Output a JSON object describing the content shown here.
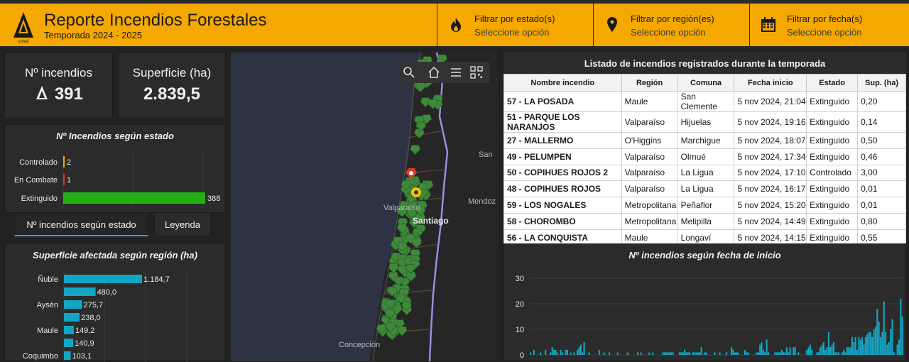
{
  "header": {
    "title": "Reporte Incendios Forestales",
    "subtitle": "Temporada 2024 - 2025",
    "logo_text": "conaf",
    "filters": [
      {
        "label": "Filtrar por estado(s)",
        "value": "Seleccione opción",
        "icon": "fire-icon"
      },
      {
        "label": "Filtrar por región(es)",
        "value": "Seleccione opción",
        "icon": "map-pin-icon"
      },
      {
        "label": "Filtrar por fecha(s)",
        "value": "Seleccione opción",
        "icon": "calendar-icon"
      }
    ]
  },
  "kpis": {
    "incendios_label": "Nº incendios",
    "incendios_value": "391",
    "superficie_label": "Superficie (ha)",
    "superficie_value": "2.839,5"
  },
  "tabs": {
    "estado": "Nº incendios según estado",
    "leyenda": "Leyenda"
  },
  "map": {
    "labels": [
      "Valparaíso",
      "Santiago",
      "Mendoz",
      "San",
      "Concepción"
    ]
  },
  "table": {
    "title": "Listado de incendios registrados durante la temporada",
    "columns": [
      "Nombre incendio",
      "Región",
      "Comuna",
      "Fecha inicio",
      "Estado",
      "Sup. (ha)"
    ],
    "rows": [
      [
        "57 - LA POSADA",
        "Maule",
        "San Clemente",
        "5 nov 2024, 21:04",
        "Extinguido",
        "0,20"
      ],
      [
        "51 - PARQUE LOS NARANJOS",
        "Valparaíso",
        "Hijuelas",
        "5 nov 2024, 19:16",
        "Extinguido",
        "0,14"
      ],
      [
        "27 - MALLERMO",
        "O'Higgins",
        "Marchigue",
        "5 nov 2024, 18:07",
        "Extinguido",
        "0,50"
      ],
      [
        "49 - PELUMPEN",
        "Valparaíso",
        "Olmué",
        "5 nov 2024, 17:34",
        "Extinguido",
        "0,46"
      ],
      [
        "50 - COPIHUES ROJOS 2",
        "Valparaíso",
        "La Ligua",
        "5 nov 2024, 17:10",
        "Controlado",
        "3,00"
      ],
      [
        "48 - COPIHUES ROJOS",
        "Valparaíso",
        "La Ligua",
        "5 nov 2024, 16:17",
        "Extinguido",
        "0,01"
      ],
      [
        "59 - LOS NOGALES",
        "Metropolitana",
        "Peñaflor",
        "5 nov 2024, 15:20",
        "Extinguido",
        "0,01"
      ],
      [
        "58 - CHOROMBO",
        "Metropolitana",
        "Melipilla",
        "5 nov 2024, 14:49",
        "Extinguido",
        "0,80"
      ],
      [
        "56 - LA CONQUISTA",
        "Maule",
        "Longaví",
        "5 nov 2024, 14:15",
        "Extinguido",
        "0,55"
      ]
    ]
  },
  "colors": {
    "header_bg": "#f5a800",
    "extinguido": "#22b014",
    "controlado": "#f5a800",
    "en_combate": "#d93a2b",
    "bar_region": "#13a6c4",
    "bar_fecha": "#13a6c4"
  },
  "chart_data": [
    {
      "type": "bar",
      "title": "Nº Incendios según estado",
      "categories": [
        "Controlado",
        "En Combate",
        "Extinguido"
      ],
      "values": [
        2,
        1,
        388
      ],
      "labels": [
        "2",
        "1",
        "388"
      ],
      "orientation": "horizontal"
    },
    {
      "type": "bar",
      "title": "Superficie afectada según región (ha)",
      "categories": [
        "Ñuble",
        "",
        "Aysén",
        "",
        "Maule",
        "",
        "Coquimbo"
      ],
      "values": [
        1184.7,
        480.0,
        275.7,
        238.0,
        149.2,
        140.9,
        103.1
      ],
      "labels": [
        "1.184,7",
        "480,0",
        "275,7",
        "238,0",
        "149,2",
        "140,9",
        "103,1"
      ],
      "orientation": "horizontal"
    },
    {
      "type": "bar",
      "title": "Nº incendios según fecha de inicio",
      "ylim": [
        0,
        30
      ],
      "yticks": [
        0,
        10,
        20,
        30
      ],
      "values": [
        1,
        0,
        2,
        0,
        0,
        0,
        1,
        0,
        0,
        2,
        0,
        0,
        1,
        3,
        2,
        2,
        1,
        0,
        2,
        1,
        0,
        2,
        2,
        0,
        1,
        0,
        1,
        0,
        2,
        3,
        4,
        1,
        5,
        0,
        0,
        1,
        0,
        0,
        0,
        0,
        0,
        2,
        0,
        0,
        1,
        0,
        0,
        1,
        0,
        0,
        0,
        0,
        1,
        0,
        0,
        0,
        0,
        0,
        1,
        0,
        0,
        0,
        0,
        0,
        1,
        0,
        1,
        0,
        0,
        0,
        0,
        1,
        0,
        1,
        0,
        0,
        0,
        0,
        0,
        1,
        1,
        1,
        1,
        1,
        1,
        1,
        0,
        0,
        0,
        1,
        1,
        1,
        2,
        1,
        1,
        1,
        0,
        1,
        1,
        1,
        1,
        1,
        3,
        0,
        1,
        1,
        0,
        0,
        0,
        0,
        1,
        0,
        0,
        1,
        0,
        0,
        0,
        1,
        0,
        0,
        3,
        2,
        1,
        1,
        1,
        0,
        0,
        0,
        2,
        1,
        1,
        0,
        0,
        0,
        0,
        1,
        1,
        4,
        5,
        2,
        1,
        6,
        1,
        0,
        0,
        0,
        1,
        1,
        1,
        1,
        2,
        1,
        1,
        3,
        1,
        3,
        0,
        3,
        3,
        0,
        1,
        0,
        0,
        0,
        0,
        2,
        3,
        4,
        2,
        0,
        0,
        1,
        1,
        3,
        4,
        5,
        2,
        3,
        9,
        3,
        4,
        5,
        1,
        1,
        1,
        0,
        1,
        2,
        1,
        3,
        3,
        3,
        7,
        5,
        7,
        2,
        7,
        6,
        7,
        4,
        7,
        8,
        9,
        9,
        7,
        10,
        11,
        18,
        13,
        7,
        9,
        21,
        9,
        4,
        5,
        10,
        14,
        1,
        0,
        4,
        6,
        22,
        15
      ]
    }
  ]
}
